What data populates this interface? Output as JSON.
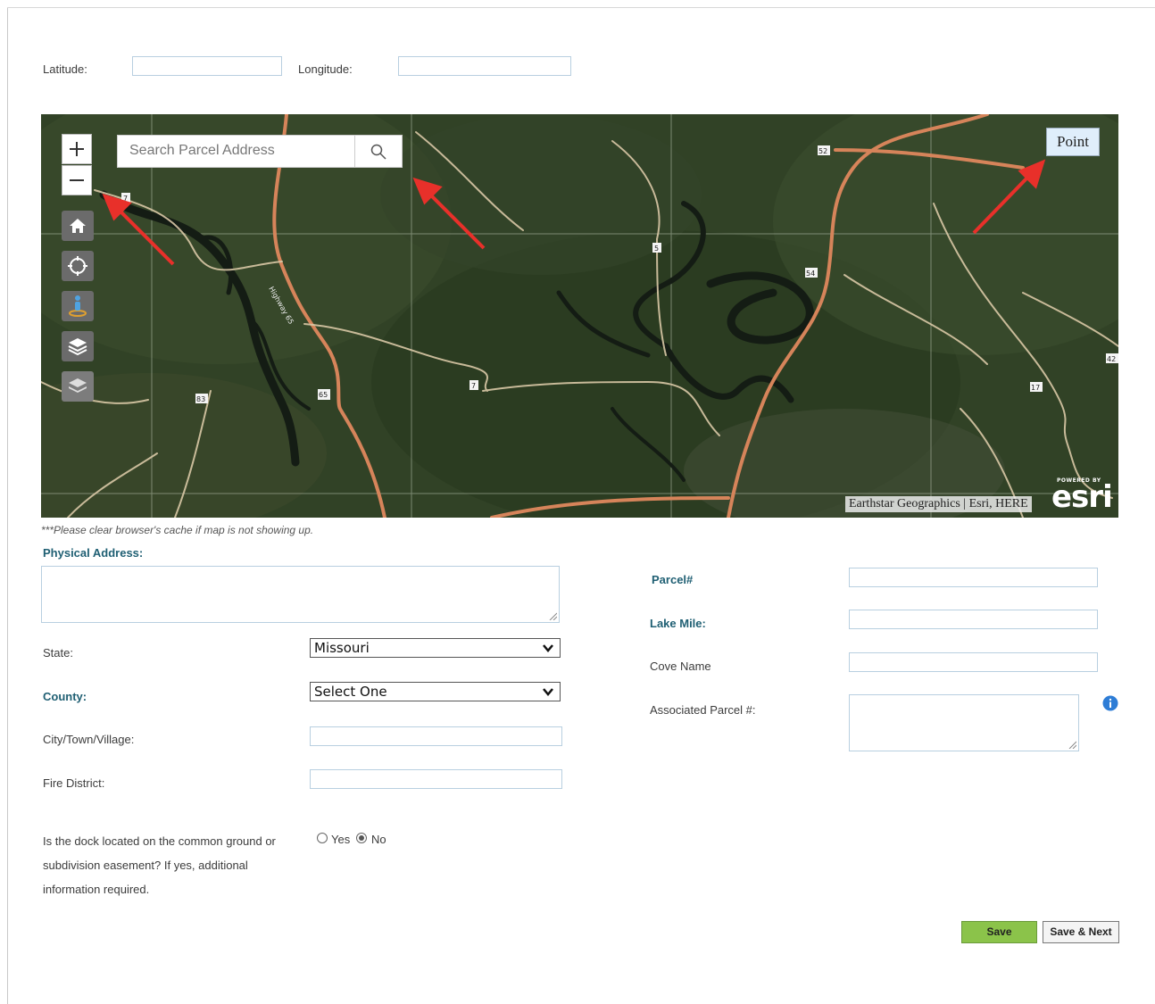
{
  "coords": {
    "latitude_label": "Latitude:",
    "latitude_value": "",
    "longitude_label": "Longitude:",
    "longitude_value": ""
  },
  "map": {
    "search_placeholder": "Search Parcel Address",
    "point_button": "Point",
    "attribution": "Earthstar Geographics | Esri, HERE",
    "logo_text": "esri",
    "logo_powered": "POWERED BY",
    "tools": [
      "zoom-in-icon",
      "zoom-out-icon",
      "home-icon",
      "locate-icon",
      "street-view-icon",
      "layers-icon",
      "basemap-icon"
    ],
    "route_labels": [
      "7",
      "5",
      "52",
      "54",
      "65",
      "83",
      "7",
      "17",
      "42"
    ],
    "road_label": "Highway 65"
  },
  "cache_note": "***Please clear browser's cache if map is not showing up.",
  "form": {
    "physical_address_label": "Physical Address:",
    "state_label": "State:",
    "state_value": "Missouri",
    "county_label": "County:",
    "county_value": "Select One",
    "city_label": "City/Town/Village:",
    "fire_district_label": "Fire District:",
    "dock_question_line1": "Is the dock located on the common ground or",
    "dock_question_line2": "subdivision easement? If yes, additional",
    "dock_question_line3": "information required.",
    "radio_yes": "Yes",
    "radio_no": "No",
    "radio_selected": "No",
    "parcel_label": "Parcel#",
    "lake_mile_label": "Lake Mile:",
    "cove_name_label": "Cove Name",
    "associated_parcel_label": "Associated Parcel #:"
  },
  "buttons": {
    "save": "Save",
    "save_next": "Save & Next"
  }
}
